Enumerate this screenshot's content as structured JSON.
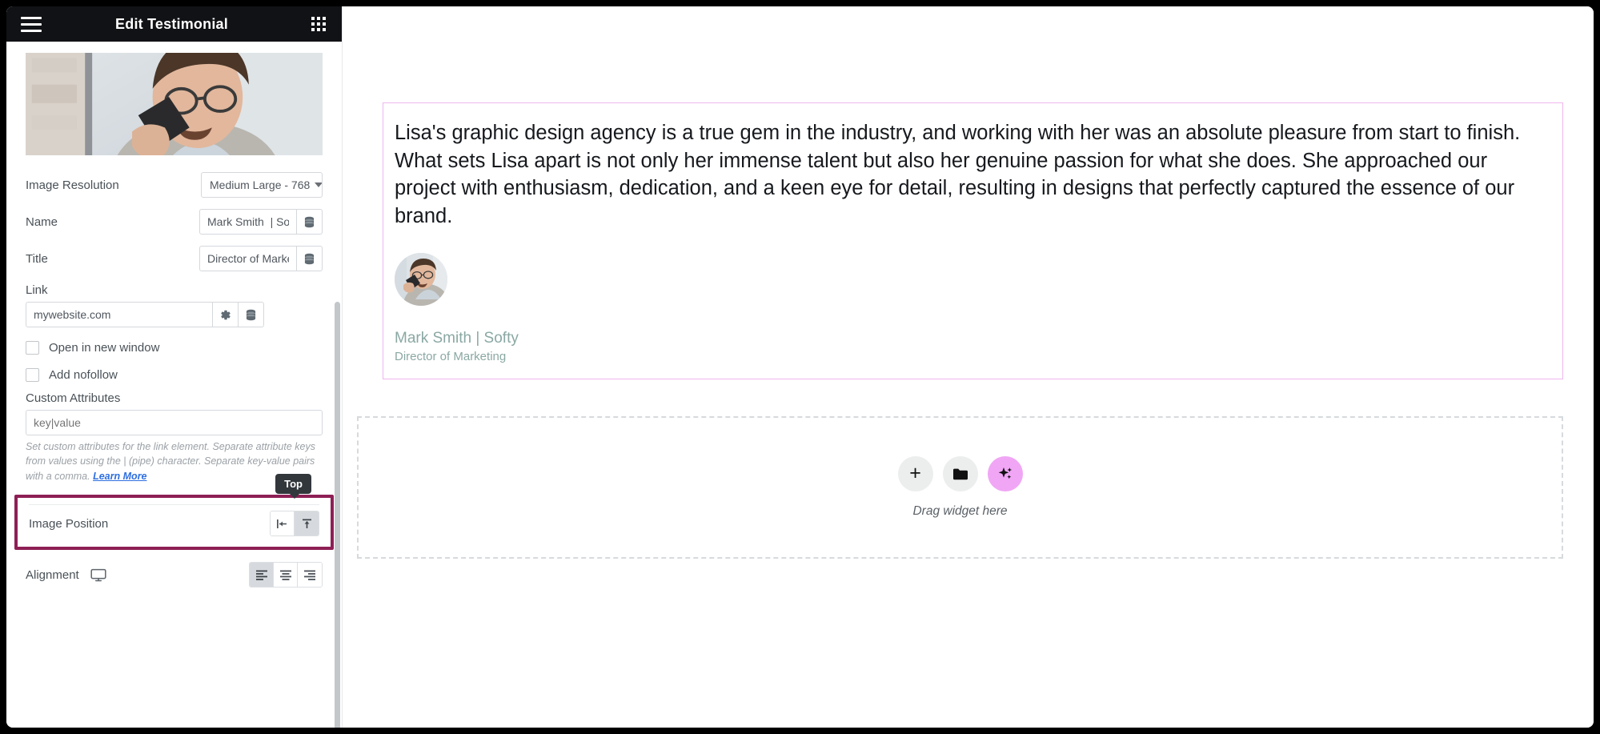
{
  "panel": {
    "header": {
      "menu_icon": "hamburger-icon",
      "title": "Edit Testimonial",
      "grid_icon": "app-grid-icon"
    },
    "fields": {
      "image_resolution": {
        "label": "Image Resolution",
        "value": "Medium Large - 768"
      },
      "name": {
        "label": "Name",
        "value": "Mark Smith  | Soft",
        "dynamic_icon": "database-icon"
      },
      "title": {
        "label": "Title",
        "value": "Director of Market",
        "dynamic_icon": "database-icon"
      },
      "link": {
        "label": "Link",
        "value": "mywebsite.com",
        "settings_icon": "gear-icon",
        "dynamic_icon": "database-icon"
      },
      "open_new_window": {
        "label": "Open in new window",
        "checked": false
      },
      "add_nofollow": {
        "label": "Add nofollow",
        "checked": false
      },
      "custom_attributes": {
        "label": "Custom Attributes",
        "placeholder": "key|value",
        "value": ""
      },
      "help": {
        "text": "Set custom attributes for the link element. Separate attribute keys from values using the | (pipe) character. Separate key-value pairs with a comma.",
        "link_label": "Learn More"
      },
      "image_position": {
        "label": "Image Position",
        "tooltip": "Top",
        "options": [
          {
            "name": "aside-icon",
            "label": "Aside",
            "selected": false
          },
          {
            "name": "top-icon",
            "label": "Top",
            "selected": true
          }
        ]
      },
      "alignment": {
        "label": "Alignment",
        "device_icon": "desktop-icon",
        "options": [
          {
            "name": "align-left-icon",
            "label": "Left",
            "selected": true
          },
          {
            "name": "align-center-icon",
            "label": "Center",
            "selected": false
          },
          {
            "name": "align-right-icon",
            "label": "Right",
            "selected": false
          }
        ]
      }
    },
    "collapse_handle": "chevron-left-icon"
  },
  "canvas": {
    "testimonial": {
      "text": "Lisa's graphic design agency is a true gem in the industry, and working with her was an absolute pleasure from start to finish. What sets Lisa apart is not only her immense talent but also her genuine passion for what she does. She approached our project with enthusiasm, dedication, and a keen eye for detail, resulting in designs that perfectly captured the essence of our brand.",
      "name": "Mark Smith | Softy",
      "title": "Director of Marketing"
    },
    "dropzone": {
      "label": "Drag widget here",
      "buttons": [
        {
          "name": "add-widget-button",
          "icon": "plus-icon"
        },
        {
          "name": "open-template-library-button",
          "icon": "folder-icon"
        },
        {
          "name": "ai-generate-button",
          "icon": "sparkles-icon"
        }
      ]
    }
  },
  "colors": {
    "header_bg": "#111215",
    "highlight_border": "#8e1f55",
    "tooltip_bg": "#32373c",
    "widget_border": "#f0b6ef",
    "ai_button": "#f0a6f5",
    "attribution_text": "#8aa8a3",
    "link_blue": "#2f6fe0"
  }
}
